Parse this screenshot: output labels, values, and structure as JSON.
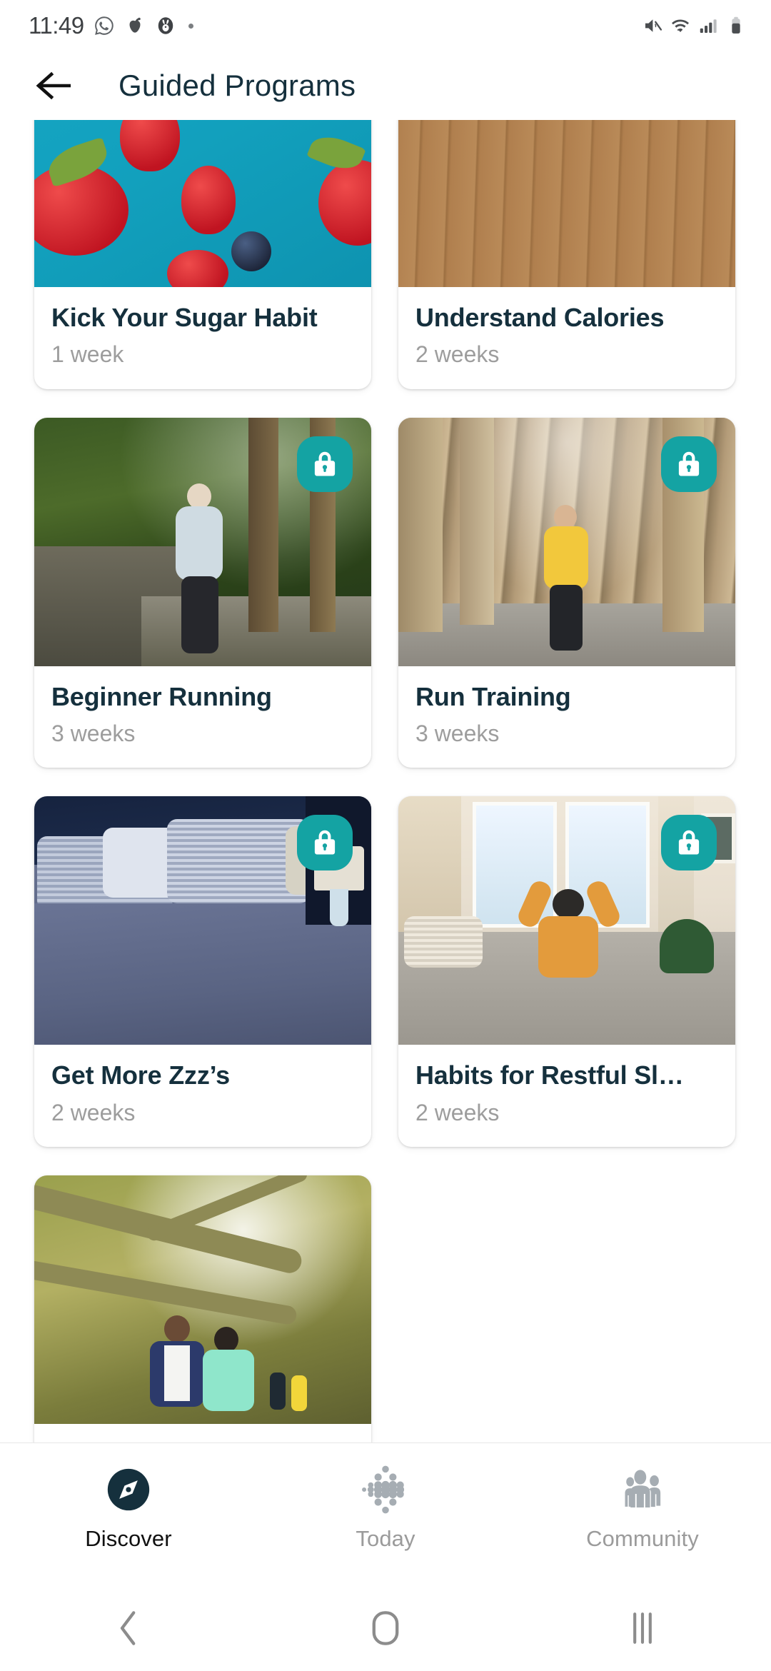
{
  "status_bar": {
    "time": "11:49",
    "left_icons": [
      "whatsapp-icon",
      "food-app-icon",
      "rabbit-app-icon",
      "overflow-dot-icon"
    ],
    "right_icons": [
      "mute-icon",
      "wifi-icon",
      "cellular-signal-icon",
      "battery-icon"
    ]
  },
  "header": {
    "back_label": "back-arrow",
    "title": "Guided Programs"
  },
  "programs": [
    {
      "title": "Kick Your Sugar Habit",
      "duration": "1 week",
      "locked": false,
      "art": "art-berries",
      "clipped": true
    },
    {
      "title": "Understand Calories",
      "duration": "2 weeks",
      "locked": false,
      "art": "art-deck",
      "clipped": false
    },
    {
      "title": "Beginner Running",
      "duration": "3 weeks",
      "locked": true,
      "art": "art-forest1",
      "clipped": false
    },
    {
      "title": "Run Training",
      "duration": "3 weeks",
      "locked": true,
      "art": "art-forest2",
      "clipped": false
    },
    {
      "title": "Get More Zzz’s",
      "duration": "2 weeks",
      "locked": true,
      "art": "art-bedroom",
      "clipped": false
    },
    {
      "title": "Habits for Restful Sl…",
      "duration": "2 weeks",
      "locked": true,
      "art": "art-bright",
      "clipped": true
    },
    {
      "title": "",
      "duration": "",
      "locked": false,
      "art": "art-oak",
      "clipped": false
    }
  ],
  "tabs": [
    {
      "label": "Discover",
      "icon": "compass-icon",
      "active": true
    },
    {
      "label": "Today",
      "icon": "fitbit-dots-icon",
      "active": false
    },
    {
      "label": "Community",
      "icon": "people-icon",
      "active": false
    }
  ],
  "system_nav": {
    "back": "nav-back-icon",
    "home": "nav-home-icon",
    "recents": "nav-recents-icon"
  },
  "colors": {
    "title_text": "#15303d",
    "subtitle_text": "#9d9d9d",
    "lock_badge": "#14a3a3",
    "active_tab": "#15303d",
    "inactive_tab": "#9b9b9b",
    "background": "#ffffff"
  }
}
